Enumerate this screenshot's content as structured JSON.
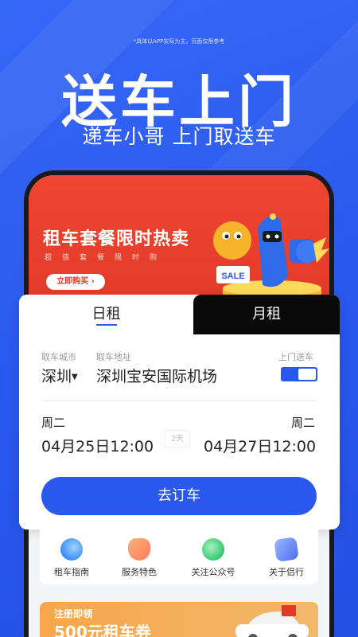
{
  "header": {
    "disclaimer": "*具体以APP实际为主，页面仅限参考",
    "headline": "送车上门",
    "subheadline": "递车小哥 上门取送车"
  },
  "banner": {
    "title": "租车套餐限时热卖",
    "subtitle": "超值套餐限时购",
    "buy_button": "立即购买 ›",
    "sale_tag": "SALE"
  },
  "booking": {
    "tabs": {
      "daily": "日租",
      "monthly": "月租"
    },
    "city_label": "取车城市",
    "city_value": "深圳",
    "address_label": "取车地址",
    "address_value": "深圳宝安国际机场",
    "delivery_label": "上门送车",
    "delivery_enabled": true,
    "pickup_weekday": "周二",
    "pickup_datetime": "04月25日12:00",
    "duration": "2天",
    "return_weekday": "周二",
    "return_datetime": "04月27日12:00",
    "order_button": "去订车"
  },
  "services": [
    {
      "label": "租车指南",
      "icon": "guide-icon"
    },
    {
      "label": "服务特色",
      "icon": "feature-icon"
    },
    {
      "label": "关注公众号",
      "icon": "wechat-icon"
    },
    {
      "label": "关于侣行",
      "icon": "about-icon"
    }
  ],
  "promo": {
    "line1": "注册即领",
    "line2": "500元租车券"
  },
  "colors": {
    "brand_blue": "#2a57ec",
    "banner_red": "#e23a28",
    "promo_orange": "#f7a64a"
  }
}
